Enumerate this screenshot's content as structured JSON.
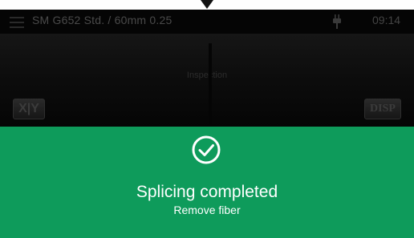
{
  "status_bar": {
    "title": "SM G652 Std. / 60mm 0.25",
    "time": "09:14",
    "menu_icon": "hamburger-menu-icon",
    "power_icon": "plug-icon"
  },
  "camera_view": {
    "label": "Inspection",
    "xy_button_label": "X|Y",
    "disp_button_label": "DISP"
  },
  "dialog": {
    "icon": "check-circle-icon",
    "title": "Splicing completed",
    "subtitle": "Remove fiber",
    "background_color": "#0e9b5b"
  }
}
